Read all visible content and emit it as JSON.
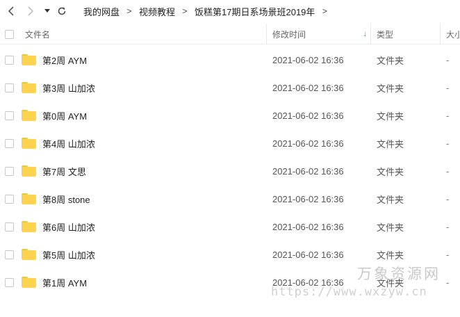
{
  "nav": {
    "back_icon": "chevron-left-icon",
    "forward_icon": "chevron-right-icon",
    "dropdown_icon": "caret-down-icon",
    "refresh_icon": "refresh-icon",
    "breadcrumb": [
      "我的网盘",
      "视频教程",
      "饭糕第17期日系场景班2019年"
    ],
    "separator": ">"
  },
  "columns": {
    "name": "文件名",
    "modified": "修改时间",
    "type": "类型",
    "size": "大小",
    "sort_arrow": "↓"
  },
  "rows": [
    {
      "name": "第2周 AYM",
      "modified": "2021-06-02 16:36",
      "type": "文件夹",
      "size": "-"
    },
    {
      "name": "第3周 山加浓",
      "modified": "2021-06-02 16:36",
      "type": "文件夹",
      "size": "-"
    },
    {
      "name": "第0周 AYM",
      "modified": "2021-06-02 16:36",
      "type": "文件夹",
      "size": "-"
    },
    {
      "name": "第4周 山加浓",
      "modified": "2021-06-02 16:36",
      "type": "文件夹",
      "size": "-"
    },
    {
      "name": "第7周 文思",
      "modified": "2021-06-02 16:36",
      "type": "文件夹",
      "size": "-"
    },
    {
      "name": "第8周 stone",
      "modified": "2021-06-02 16:36",
      "type": "文件夹",
      "size": "-"
    },
    {
      "name": "第6周 山加浓",
      "modified": "2021-06-02 16:36",
      "type": "文件夹",
      "size": "-"
    },
    {
      "name": "第5周 山加浓",
      "modified": "2021-06-02 16:36",
      "type": "文件夹",
      "size": "-"
    },
    {
      "name": "第1周 AYM",
      "modified": "2021-06-02 16:36",
      "type": "文件夹",
      "size": "-"
    }
  ],
  "watermark": {
    "title": "万象资源网",
    "url": "https://www.wxzyw.cn"
  },
  "colors": {
    "folder": "#fcd34d",
    "sort_accent": "#1e88e5"
  }
}
